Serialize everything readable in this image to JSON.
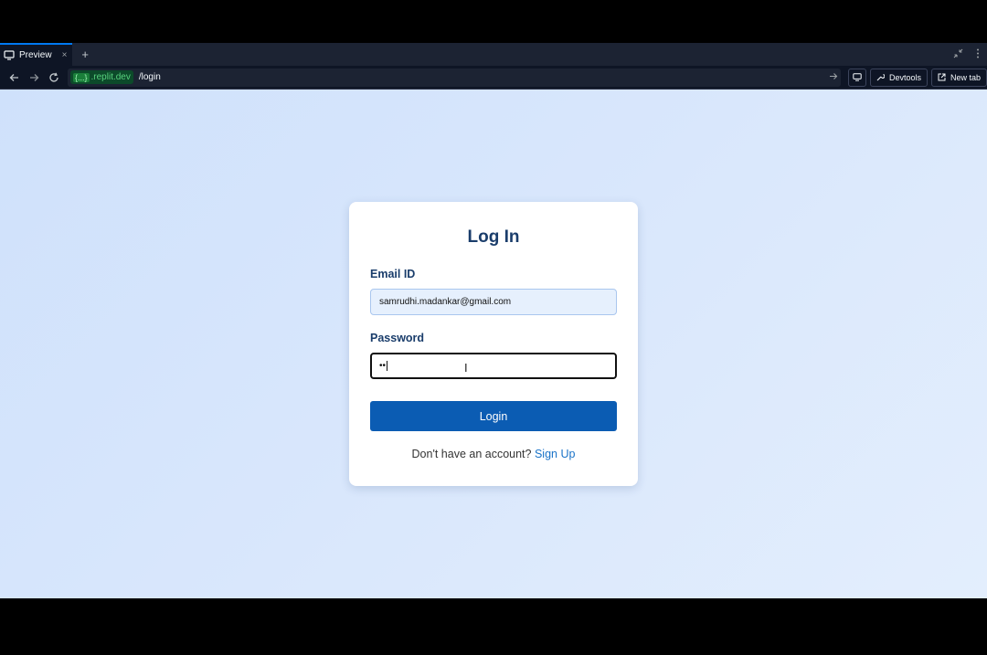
{
  "browser": {
    "tab_title": "Preview",
    "tab_close": "×",
    "tab_add": "+",
    "domain_prefix": "{...}",
    "domain": ".replit.dev",
    "path": "/login",
    "devtools_label": "Devtools",
    "newtab_label": "New tab"
  },
  "login": {
    "title": "Log In",
    "email_label": "Email ID",
    "email_value": "samrudhi.madankar@gmail.com",
    "password_label": "Password",
    "password_value": "••",
    "submit_label": "Login",
    "signup_prompt": "Don't have an account?",
    "signup_link": "Sign Up"
  },
  "colors": {
    "primary": "#0b5cb3",
    "title": "#1a3d6b",
    "link": "#1a73c8"
  }
}
